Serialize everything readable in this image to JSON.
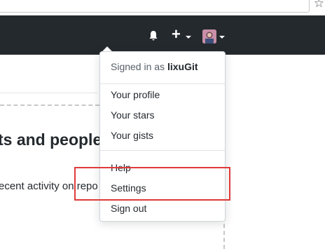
{
  "header": {
    "icons": [
      "bell-icon",
      "plus-icon",
      "avatar"
    ],
    "avatar_color": "#d7a3b6"
  },
  "main": {
    "heading": "ts and people",
    "subtext": "ecent activity on repo"
  },
  "user_menu": {
    "signed_in_prefix": "Signed in as",
    "username": "lixuGit",
    "items": [
      "Your profile",
      "Your stars",
      "Your gists",
      "Help",
      "Settings",
      "Sign out"
    ]
  },
  "colors": {
    "header_bg": "#24292e",
    "highlight": "#e03a3a"
  }
}
